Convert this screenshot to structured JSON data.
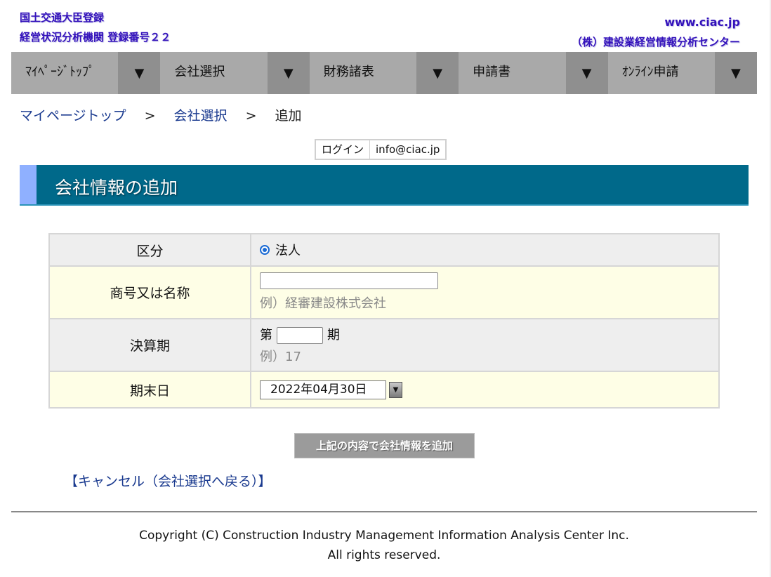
{
  "header": {
    "left_line1": "国土交通大臣登録",
    "left_line2": "経営状況分析機関 登録番号２２",
    "right_line1": "www.ciac.jp",
    "right_line2": "（株）建設業経営情報分析センター"
  },
  "nav": {
    "items": [
      {
        "label": "ﾏｲﾍﾟｰｼﾞﾄｯﾌﾟ",
        "arrow": "▼"
      },
      {
        "label": "会社選択",
        "arrow": "▼"
      },
      {
        "label": "財務諸表",
        "arrow": "▼"
      },
      {
        "label": "申請書",
        "arrow": "▼"
      },
      {
        "label": "ｵﾝﾗｲﾝ申請",
        "arrow": "▼"
      }
    ]
  },
  "breadcrumb": {
    "items": [
      "マイページトップ",
      "会社選択",
      "追加"
    ],
    "separator": ">"
  },
  "login": {
    "label": "ログイン",
    "email": "info@ciac.jp"
  },
  "section": {
    "title": "会社情報の追加"
  },
  "form": {
    "kubun": {
      "label": "区分",
      "option": "法人"
    },
    "name": {
      "label": "商号又は名称",
      "value": "",
      "example": "例）経審建設株式会社"
    },
    "period": {
      "label": "決算期",
      "prefix": "第",
      "suffix": "期",
      "value": "",
      "example": "例）17"
    },
    "end_date": {
      "label": "期末日",
      "value": "2022年04月30日"
    }
  },
  "actions": {
    "submit_label": "上記の内容で会社情報を追加",
    "cancel_label": "【キャンセル（会社選択へ戻る）】"
  },
  "footer": {
    "line1": "Copyright (C) Construction Industry Management Information Analysis Center Inc.",
    "line2": "All rights reserved."
  },
  "colors": {
    "header_text": "#3311bb",
    "nav_bg": "#a9a9a9",
    "section_bg": "#00698a",
    "link": "#1a3a8f"
  }
}
